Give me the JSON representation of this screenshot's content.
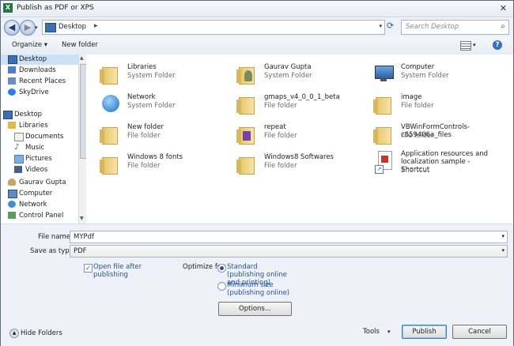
{
  "window": {
    "title": "Publish as PDF or XPS"
  },
  "address": {
    "location": "Desktop",
    "separator": "▸"
  },
  "search": {
    "placeholder": "Search Desktop"
  },
  "toolbar": {
    "organize": "Organize ▾",
    "new_folder": "New folder"
  },
  "sidebar": {
    "items": [
      {
        "label": "Desktop",
        "icon": "desktop-icon",
        "selected": true
      },
      {
        "label": "Downloads",
        "icon": "downloads-icon"
      },
      {
        "label": "Recent Places",
        "icon": "recent-places-icon"
      },
      {
        "label": "SkyDrive",
        "icon": "skydrive-icon"
      },
      {
        "label": "Desktop",
        "icon": "desktop-icon"
      },
      {
        "label": "Libraries",
        "icon": "libraries-icon"
      },
      {
        "label": "Documents",
        "icon": "documents-icon"
      },
      {
        "label": "Music",
        "icon": "music-icon"
      },
      {
        "label": "Pictures",
        "icon": "pictures-icon"
      },
      {
        "label": "Videos",
        "icon": "videos-icon"
      },
      {
        "label": "Gaurav Gupta",
        "icon": "user-icon"
      },
      {
        "label": "Computer",
        "icon": "computer-icon"
      },
      {
        "label": "Network",
        "icon": "network-icon"
      },
      {
        "label": "Control Panel",
        "icon": "control-panel-icon"
      }
    ]
  },
  "files": [
    {
      "name": "Libraries",
      "type": "System Folder",
      "icon": "libraries-icon"
    },
    {
      "name": "Gaurav Gupta",
      "type": "System Folder",
      "icon": "user-folder-icon"
    },
    {
      "name": "Computer",
      "type": "System Folder",
      "icon": "computer-icon"
    },
    {
      "name": "Network",
      "type": "System Folder",
      "icon": "network-icon"
    },
    {
      "name": "gmaps_v4_0_0_1_beta",
      "type": "File folder",
      "icon": "folder-icon"
    },
    {
      "name": "image",
      "type": "File folder",
      "icon": "folder-icon"
    },
    {
      "name": "New folder",
      "type": "File folder",
      "icon": "folder-icon"
    },
    {
      "name": "repeat",
      "type": "File folder",
      "icon": "folder-icon"
    },
    {
      "name": "VBWinFormControls-c859406a_files",
      "type": "File folder",
      "icon": "folder-icon"
    },
    {
      "name": "Windows 8 fonts",
      "type": "File folder",
      "icon": "folder-icon"
    },
    {
      "name": "Windows8 Softwares",
      "type": "File folder",
      "icon": "folder-icon"
    },
    {
      "name": "Application resources and localization sample - Shortcut",
      "type": "Shortcut",
      "icon": "shortcut-icon"
    }
  ],
  "form": {
    "file_name_label": "File name:",
    "file_name_value": "MYPdf",
    "save_as_label": "Save as type:",
    "save_as_value": "PDF",
    "open_after": "Open file after publishing",
    "optimize_label": "Optimize for:",
    "standard": "Standard (publishing online and printing)",
    "minimum": "Minimum size (publishing online)",
    "options_button": "Options..."
  },
  "footer": {
    "hide_folders": "Hide Folders",
    "tools": "Tools",
    "publish": "Publish",
    "cancel": "Cancel"
  },
  "colors": {
    "accent": "#1f4f9b",
    "selection": "#cce0f7"
  }
}
